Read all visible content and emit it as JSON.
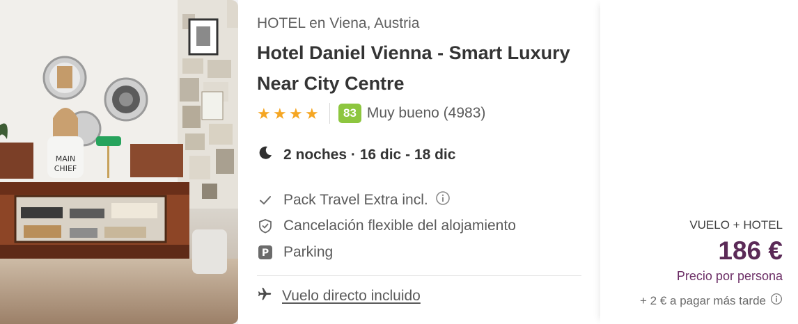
{
  "hotel": {
    "location_line": "HOTEL en Viena, Austria",
    "name": "Hotel Daniel Vienna - Smart Luxury Near City Centre",
    "stars": 4,
    "star_color": "#f5a623",
    "score": "83",
    "score_color": "#8dc63f",
    "rating_label": "Muy bueno (4983)"
  },
  "stay": {
    "icon": "moon-icon",
    "summary": "2 noches · 16 dic - 18 dic"
  },
  "features": [
    {
      "icon": "check-icon",
      "label": "Pack Travel Extra incl.",
      "info": true
    },
    {
      "icon": "shield-check-icon",
      "label": "Cancelación flexible del alojamiento",
      "info": false
    },
    {
      "icon": "parking-icon",
      "label": "Parking",
      "info": false
    }
  ],
  "flight": {
    "icon": "plane-icon",
    "label": "Vuelo directo incluido"
  },
  "price": {
    "type": "VUELO + HOTEL",
    "amount": "186 €",
    "per": "Precio por persona",
    "extra": "+ 2 € a pagar más tarde",
    "accent_color": "#5b2a57"
  }
}
